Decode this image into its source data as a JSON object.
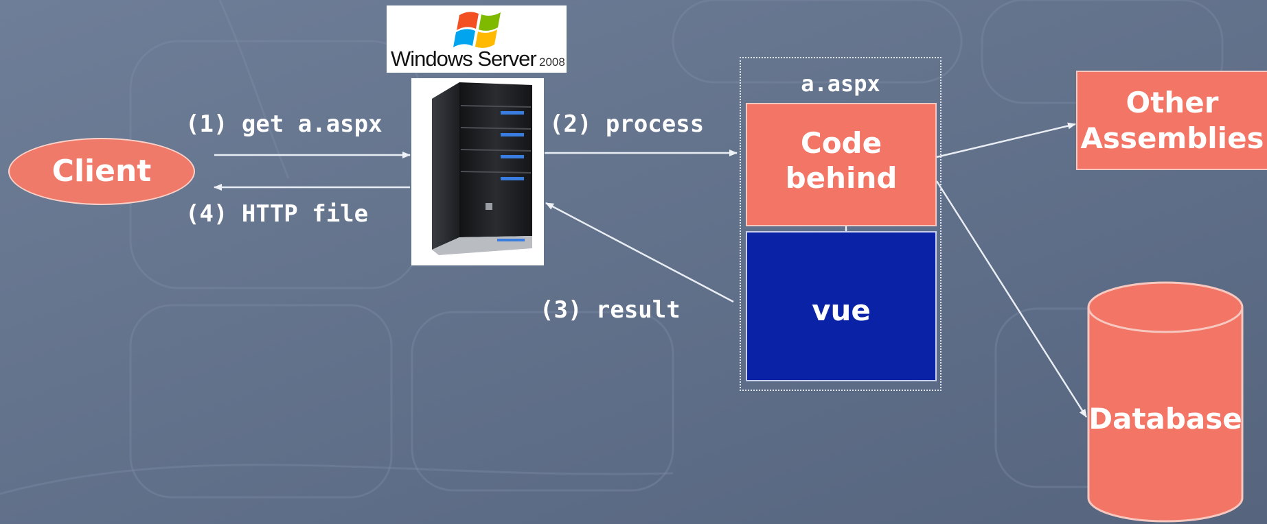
{
  "logo": {
    "text": "Windows Server 2008"
  },
  "nodes": {
    "client": "Client",
    "aspx_title": "a.aspx",
    "code_behind": [
      "Code",
      "behind"
    ],
    "vue": "vue",
    "other_assemblies": [
      "Other",
      "Assemblies"
    ],
    "database": "Database"
  },
  "steps": {
    "get": "(1) get a.aspx",
    "process": "(2) process",
    "result": "(3) result",
    "http_file": "(4) HTTP file"
  },
  "colors": {
    "salmon": "#f27566",
    "navy_box": "#0a23a6",
    "background": "#66758e",
    "server_blue_led": "#3a7de0"
  },
  "icons": {
    "logo": "windows-flag-icon",
    "server": "server-tower-icon",
    "database": "database-cylinder-icon"
  }
}
